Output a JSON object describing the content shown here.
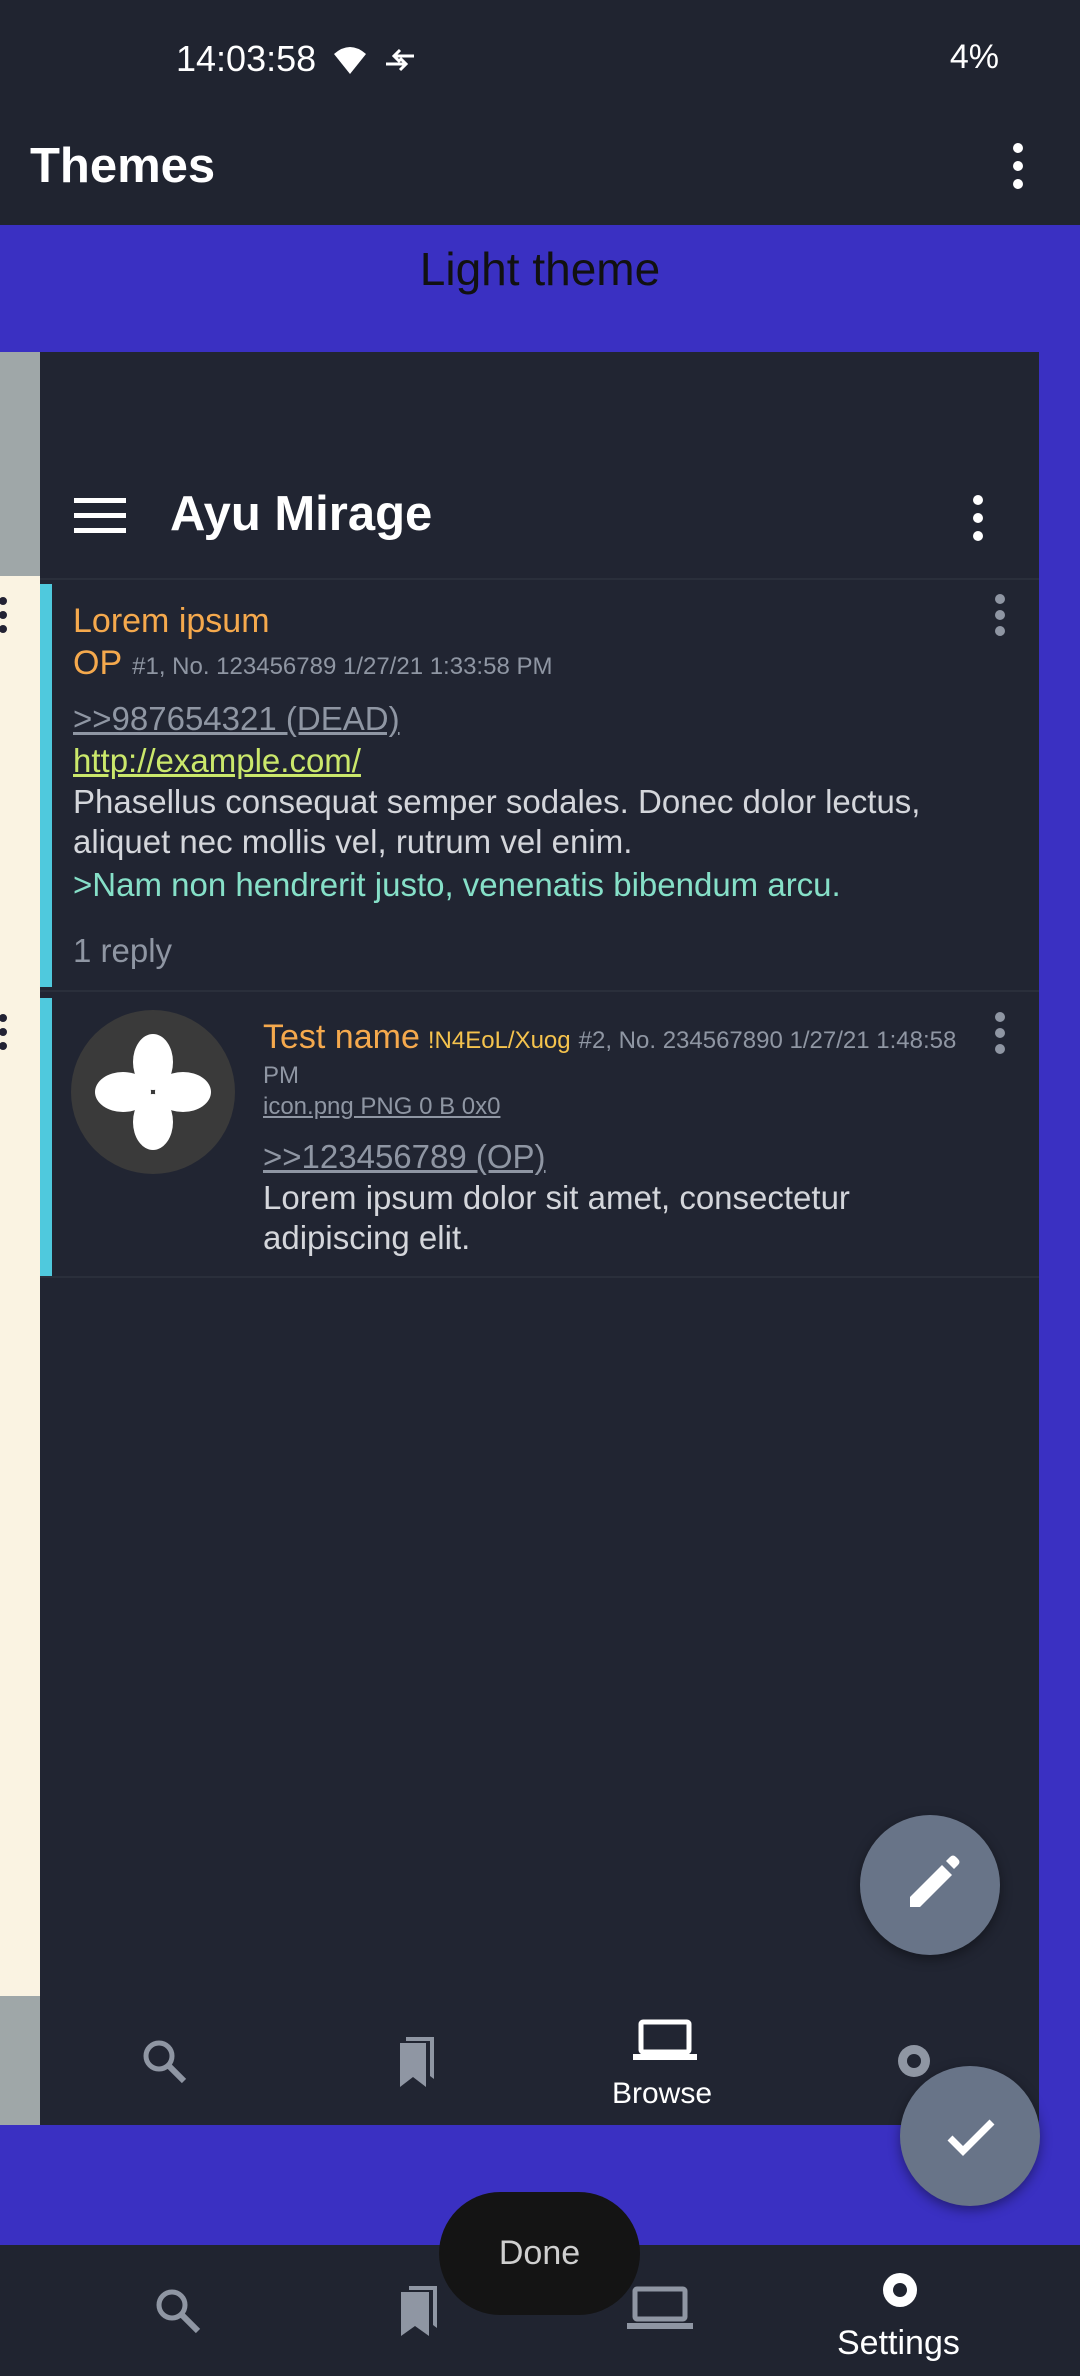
{
  "status_bar": {
    "time": "14:03:58",
    "battery": "4%"
  },
  "app_bar": {
    "title": "Themes"
  },
  "theme": {
    "label": "Light theme"
  },
  "preview": {
    "title": "Ayu Mirage",
    "post1": {
      "subject": "Lorem ipsum",
      "name": "OP",
      "meta": "#1, No. 123456789 1/27/21 1:33:58 PM",
      "quote": ">>987654321 (DEAD)",
      "link": "http://example.com/",
      "body": "Phasellus consequat semper sodales. Donec dolor lectus, aliquet nec mollis vel, rutrum vel enim.",
      "greentext": ">Nam non hendrerit justo, venenatis bibendum arcu.",
      "replies": "1 reply"
    },
    "post2": {
      "name": "Test name",
      "tripcode": "!N4EoL/Xuog",
      "meta": "#2, No. 234567890 1/27/21 1:48:58",
      "meta2": "PM",
      "file": "icon.png PNG 0 B 0x0",
      "quote": ">>123456789 (OP)",
      "body": "Lorem ipsum dolor sit amet, consectetur adipiscing elit."
    },
    "nav": {
      "browse": "Browse"
    }
  },
  "toast": {
    "text": "Done"
  },
  "bottom_nav": {
    "settings": "Settings"
  },
  "colors": {
    "accent_panel": "#3a30c2",
    "surface": "#202430",
    "post_accent": "#4fc9dd",
    "subject": "#f5a94d"
  }
}
